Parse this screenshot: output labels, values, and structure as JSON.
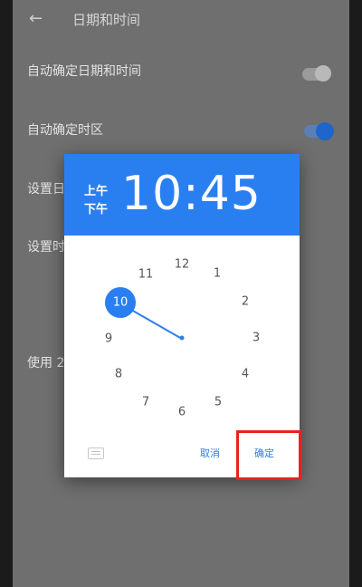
{
  "appbar": {
    "back_icon": "back-arrow-icon",
    "title": "日期和时间"
  },
  "settings": {
    "auto_datetime": {
      "label": "自动确定日期和时间",
      "enabled": false
    },
    "auto_timezone": {
      "label": "自动确定时区",
      "enabled": true
    },
    "set_date": {
      "label": "设置日"
    },
    "set_time": {
      "label": "设置时"
    },
    "use_24h": {
      "label": "使用 2"
    }
  },
  "time_picker": {
    "am_label": "上午",
    "pm_label": "下午",
    "time_text": "10:45",
    "hour": 10,
    "minute": 45,
    "clock_numbers": [
      "12",
      "1",
      "2",
      "3",
      "4",
      "5",
      "6",
      "7",
      "8",
      "9",
      "10",
      "11"
    ],
    "selected_number": "10",
    "keyboard_icon": "keyboard-icon",
    "cancel_label": "取消",
    "ok_label": "确定"
  },
  "colors": {
    "accent": "#2a7ff0",
    "highlight_box": "#e8231f"
  }
}
